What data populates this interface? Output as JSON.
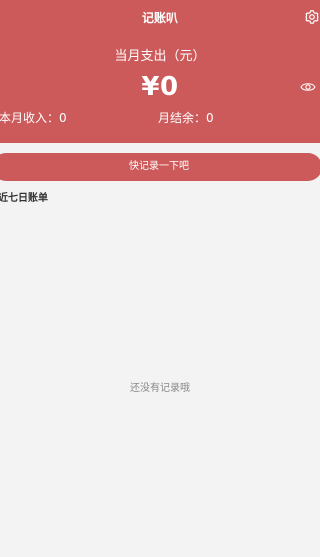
{
  "colors": {
    "accent": "#cd5a5a",
    "background": "#f3f3f3",
    "text_on_accent": "#ffffff",
    "empty_text": "#8a8a8a"
  },
  "header": {
    "title": "记账叭",
    "settings_icon": "gear-icon",
    "month_expense_label": "当月支出（元）",
    "month_expense_amount": "¥0",
    "visibility_icon": "eye-icon",
    "month_income": "本月收入：0",
    "month_balance": "月结余：0"
  },
  "quick_record": {
    "label": "快记录一下吧"
  },
  "recent": {
    "title": "近七日账单",
    "empty_text": "还没有记录哦"
  }
}
